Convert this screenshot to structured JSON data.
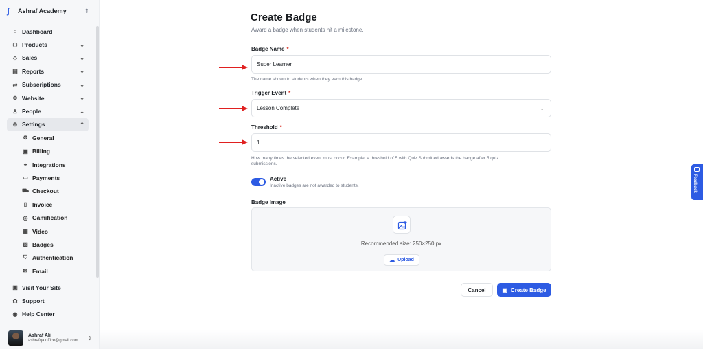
{
  "sidebar": {
    "brand": "Ashraf Academy",
    "items": [
      {
        "label": "Dashboard",
        "icon": "home-icon",
        "glyph": "⌂",
        "chev": ""
      },
      {
        "label": "Products",
        "icon": "box-icon",
        "glyph": "⬡",
        "chev": "⌄"
      },
      {
        "label": "Sales",
        "icon": "tag-icon",
        "glyph": "◇",
        "chev": "⌄"
      },
      {
        "label": "Reports",
        "icon": "chart-icon",
        "glyph": "▤",
        "chev": "⌄"
      },
      {
        "label": "Subscriptions",
        "icon": "repeat-icon",
        "glyph": "⇄",
        "chev": "⌄"
      },
      {
        "label": "Website",
        "icon": "globe-icon",
        "glyph": "⊕",
        "chev": "⌄"
      },
      {
        "label": "People",
        "icon": "user-icon",
        "glyph": "♙",
        "chev": "⌄"
      },
      {
        "label": "Settings",
        "icon": "gear-icon",
        "glyph": "⚙",
        "chev": "⌃"
      }
    ],
    "settings_sub": [
      {
        "label": "General",
        "icon": "gear-icon",
        "glyph": "⚙"
      },
      {
        "label": "Billing",
        "icon": "billing-icon",
        "glyph": "▣"
      },
      {
        "label": "Integrations",
        "icon": "link-icon",
        "glyph": "⚭"
      },
      {
        "label": "Payments",
        "icon": "card-icon",
        "glyph": "▭"
      },
      {
        "label": "Checkout",
        "icon": "cart-icon",
        "glyph": "⛟"
      },
      {
        "label": "Invoice",
        "icon": "file-icon",
        "glyph": "▯"
      },
      {
        "label": "Gamification",
        "icon": "gamepad-icon",
        "glyph": "◎"
      },
      {
        "label": "Video",
        "icon": "video-icon",
        "glyph": "▦"
      },
      {
        "label": "Badges",
        "icon": "badge-icon",
        "glyph": "▨"
      },
      {
        "label": "Authentication",
        "icon": "shield-icon",
        "glyph": "⛉"
      },
      {
        "label": "Email",
        "icon": "mail-icon",
        "glyph": "✉"
      }
    ],
    "bottom": [
      {
        "label": "Visit Your Site",
        "icon": "external-icon",
        "glyph": "▣"
      },
      {
        "label": "Support",
        "icon": "headset-icon",
        "glyph": "☊"
      },
      {
        "label": "Help Center",
        "icon": "help-icon",
        "glyph": "◉"
      }
    ],
    "user": {
      "name": "Ashraf Ali",
      "email": "ashrafqa.office@gmail.com"
    }
  },
  "form": {
    "title": "Create Badge",
    "subtitle": "Award a badge when students hit a milestone.",
    "badge_name_label": "Badge Name",
    "badge_name_value": "Super Learner",
    "badge_name_hint": "The name shown to students when they earn this badge.",
    "trigger_label": "Trigger Event",
    "trigger_value": "Lesson Complete",
    "threshold_label": "Threshold",
    "threshold_value": "1",
    "threshold_hint_1": "How many times the selected event must occur. Example: a threshold of 5 with Quiz Submitted awards the badge after 5 quiz",
    "threshold_hint_2": "submissions.",
    "active_label": "Active",
    "active_hint": "Inactive badges are not awarded to students.",
    "active_on": true,
    "image_label": "Badge Image",
    "recommended": "Recommended size: 250×250 px",
    "upload_label": "Upload",
    "cancel_label": "Cancel",
    "create_label": "Create Badge",
    "required_mark": "*"
  },
  "feedback_label": "Feedback",
  "colors": {
    "accent": "#2d5be3",
    "annotation_arrow": "#e02020",
    "required": "#d93025"
  }
}
